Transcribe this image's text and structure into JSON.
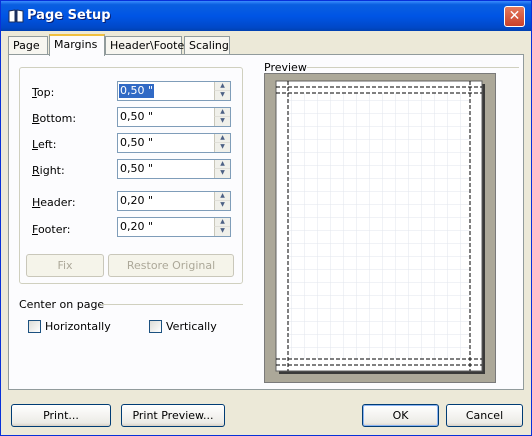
{
  "window": {
    "title": "Page Setup",
    "close_glyph": "✕",
    "title_icon": "book-icon"
  },
  "tabs": [
    {
      "label": "Page",
      "active": false
    },
    {
      "label": "Margins",
      "active": true
    },
    {
      "label": "Header\\Footer",
      "active": false
    },
    {
      "label": "Scaling",
      "active": false
    }
  ],
  "margins": {
    "fields": [
      {
        "label": "Top:",
        "key": "T",
        "value": "0,50 \""
      },
      {
        "label": "Bottom:",
        "key": "B",
        "value": "0,50 \""
      },
      {
        "label": "Left:",
        "key": "L",
        "value": "0,50 \""
      },
      {
        "label": "Right:",
        "key": "R",
        "value": "0,50 \""
      },
      {
        "label": "Header:",
        "key": "H",
        "value": "0,20 \""
      },
      {
        "label": "Footer:",
        "key": "F",
        "value": "0,20 \""
      }
    ],
    "fix_label": "Fix",
    "restore_label": "Restore Original"
  },
  "center": {
    "title": "Center on page",
    "horizontally": "Horizontally",
    "vertically": "Vertically",
    "horizontally_checked": false,
    "vertically_checked": false
  },
  "preview": {
    "title": "Preview"
  },
  "footer": {
    "print_label": "Print...",
    "print_preview_label": "Print Preview...",
    "ok_label": "OK",
    "cancel_label": "Cancel"
  },
  "colors": {
    "titlebar": "#0055E5",
    "selection": "#316AC5",
    "face": "#ECE9D8"
  }
}
